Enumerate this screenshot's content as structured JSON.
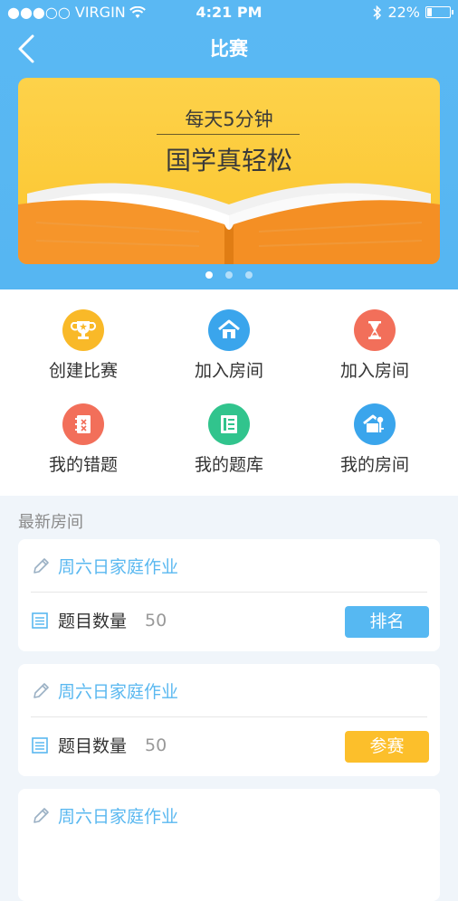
{
  "status_bar": {
    "carrier": "●●●○○ VIRGIN",
    "time": "4:21 PM",
    "battery": "22%",
    "battery_level": 0.22
  },
  "nav": {
    "title": "比赛"
  },
  "banner": {
    "line1": "每天5分钟",
    "line2": "国学真轻松",
    "page_count": 3,
    "active_page": 0
  },
  "menu": [
    {
      "label": "创建比赛",
      "icon": "trophy-icon",
      "color": "#f9b928"
    },
    {
      "label": "加入房间",
      "icon": "house-icon",
      "color": "#3aa5ec"
    },
    {
      "label": "加入房间",
      "icon": "hourglass-icon",
      "color": "#f26f5a"
    },
    {
      "label": "我的错题",
      "icon": "notebook-icon",
      "color": "#f26f5a"
    },
    {
      "label": "我的题库",
      "icon": "bookshelf-icon",
      "color": "#31c48d"
    },
    {
      "label": "我的房间",
      "icon": "home-key-icon",
      "color": "#3aa5ec"
    }
  ],
  "section": {
    "title": "最新房间"
  },
  "rooms": [
    {
      "title": "周六日家庭作业",
      "count_label": "题目数量",
      "count": "50",
      "button": "排名",
      "button_color": "#56b8f2"
    },
    {
      "title": "周六日家庭作业",
      "count_label": "题目数量",
      "count": "50",
      "button": "参赛",
      "button_color": "#fcbf2b"
    },
    {
      "title": "周六日家庭作业"
    }
  ]
}
